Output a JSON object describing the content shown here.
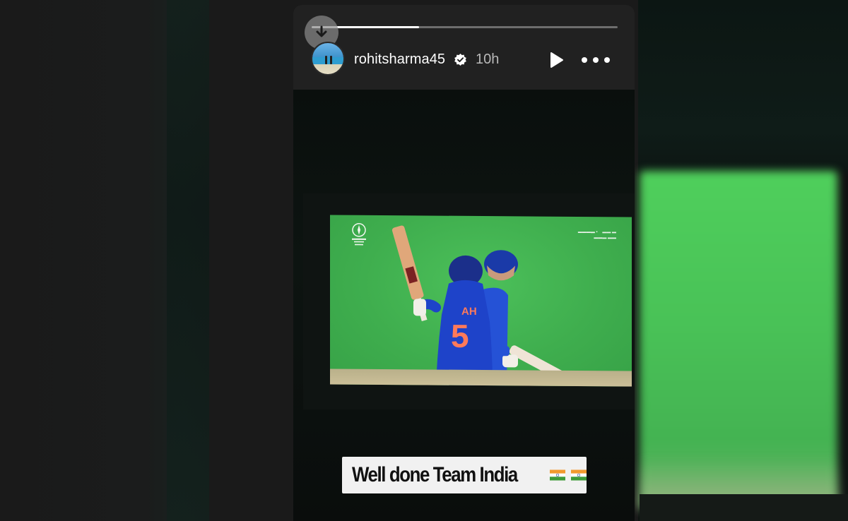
{
  "story": {
    "username": "rohitsharma45",
    "time_ago": "10h",
    "progress": 0.35,
    "caption": "Well done Team India",
    "caption_flags": [
      "india-flag",
      "india-flag"
    ]
  },
  "icons": {
    "download": "download-arrow-icon",
    "verified": "verified-badge-icon",
    "play": "play-icon",
    "more": "more-options-icon"
  },
  "colors": {
    "header_bg": "#212121",
    "verified_badge": "#ffffff",
    "jersey_blue": "#1d4fd8",
    "grass": "#43b553"
  }
}
